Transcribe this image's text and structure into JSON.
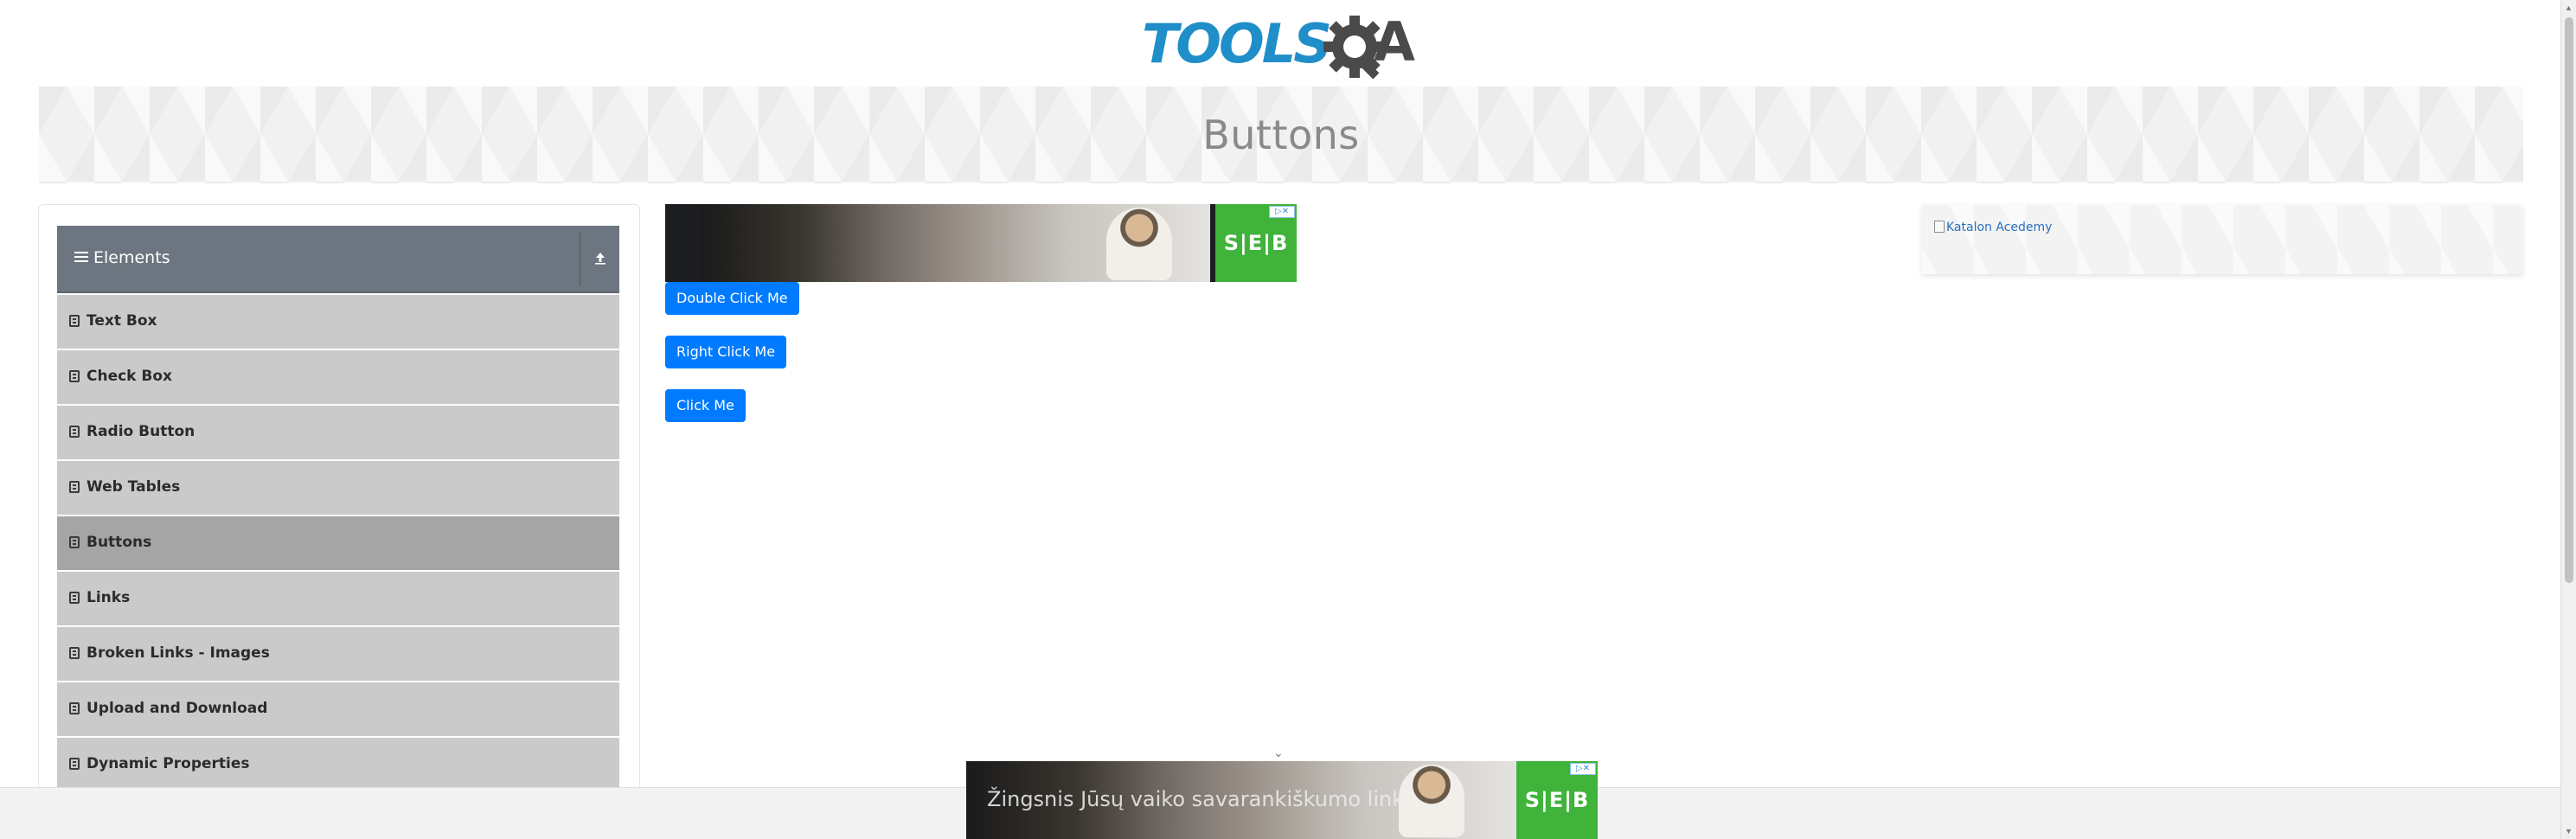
{
  "header": {
    "logo_text": "TOOLS",
    "logo_suffix": "A",
    "logo_icon": "gear-q-icon"
  },
  "page": {
    "title": "Buttons"
  },
  "sidebar": {
    "group_title": "Elements",
    "group_icon": "hamburger-icon",
    "collapse_icon": "collapse-arrow-icon",
    "items": [
      {
        "label": "Text Box",
        "icon": "document-icon",
        "active": false
      },
      {
        "label": "Check Box",
        "icon": "document-icon",
        "active": false
      },
      {
        "label": "Radio Button",
        "icon": "document-icon",
        "active": false
      },
      {
        "label": "Web Tables",
        "icon": "document-icon",
        "active": false
      },
      {
        "label": "Buttons",
        "icon": "document-icon",
        "active": true
      },
      {
        "label": "Links",
        "icon": "document-icon",
        "active": false
      },
      {
        "label": "Broken Links - Images",
        "icon": "document-icon",
        "active": false
      },
      {
        "label": "Upload and Download",
        "icon": "document-icon",
        "active": false
      },
      {
        "label": "Dynamic Properties",
        "icon": "document-icon",
        "active": false
      }
    ]
  },
  "buttons": {
    "double_click": "Double Click Me",
    "right_click": "Right Click Me",
    "click": "Click Me"
  },
  "ads": {
    "top_brand": "S|E|B",
    "bottom_brand": "S|E|B",
    "bottom_tagline": "Žingsnis Jūsų vaiko savarankiškumo link",
    "right_alt_text": "Katalon Acedemy"
  },
  "colors": {
    "primary_button": "#007bff",
    "sidebar_header": "#6d7680",
    "menu_item": "#cacaca",
    "menu_item_active": "#a5a5a5",
    "logo_blue": "#1f8ec9",
    "ad_green": "#40b33b"
  }
}
